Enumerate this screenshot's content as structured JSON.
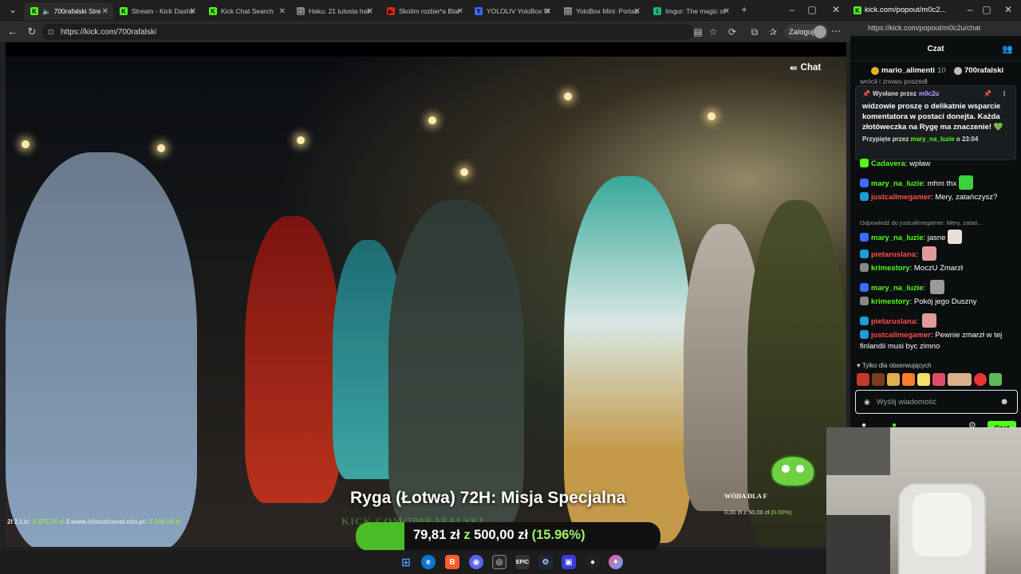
{
  "main_window": {
    "tabs": [
      {
        "label": "700rafalski Stre",
        "favicon": "kick-icon",
        "active": true
      },
      {
        "label": "Stream - Kick Dashb",
        "favicon": "kick-icon",
        "active": false
      },
      {
        "label": "Kick Chat Search",
        "favicon": "chat-search-icon",
        "active": false
      },
      {
        "label": "Haku: 21 tulosta hak",
        "favicon": "page-icon",
        "active": false
      },
      {
        "label": "Skolim rozbie*a Blar",
        "favicon": "youtube-icon",
        "active": false
      },
      {
        "label": "YOLOLIV YoloBox M",
        "favicon": "yololiv-icon",
        "active": false
      },
      {
        "label": "YoloBox Mini: Portab",
        "favicon": "page-icon",
        "active": false
      },
      {
        "label": "Imgur: The magic of",
        "favicon": "imgur-icon",
        "active": false
      }
    ],
    "url": "https://kick.com/700rafalski",
    "login_label": "Zaloguj"
  },
  "video": {
    "chat_toggle_label": "Chat",
    "headline": "Ryga (Łotwa) 72H: Misja Specjalna",
    "donors_text_pre": "2ł   2.Liz: ",
    "donor2_amount": "2 575.76 zł",
    "donors_text_mid": "   3.www.hitoszkomat.cba.pl: ",
    "donor3_amount": "2 106.06 zł",
    "watermark": "KICK.COM/700RAFALSKI",
    "goal": {
      "current": "79,81 zł",
      "connector": "z",
      "target": "500,00 zł",
      "percent_label": "(15.96%)",
      "progress": 0.1596
    },
    "mascot_label": "WÓDA DLA F",
    "mascot_goal_current": "0,00 zł z 50,00 zł",
    "mascot_goal_pct": "(0.00%)"
  },
  "chat_window": {
    "title": "kick.com/popout/m0c2...",
    "url": "https://kick.com/popout/m0c2u/chat",
    "header_title": "Czat",
    "leaderboard": [
      {
        "user": "mario_alimenti",
        "count": "10",
        "medal_color": "#e6b422"
      },
      {
        "user": "700rafalski",
        "count": "",
        "medal_color": "#c0c0c0"
      }
    ],
    "overflow_text": "wrócił i znowu poszedł",
    "pinned": {
      "sent_by_label": "Wysłane przez",
      "sender": "m0c2u",
      "message": "widzowie proszę o delikatnie wsparcie komentatora w postaci donejta. Każda złotóweczka na Rygę ma znaczenie! 💚",
      "pinned_by_label": "Przypięte przez",
      "pinned_by_user": "mary_na_luzie",
      "pinned_time": "o 23:04"
    },
    "messages": [
      {
        "user": "Cadavera",
        "text": "wpław",
        "user_color": "#53fc18"
      },
      {
        "user": "mary_na_luzie",
        "text": "mhm thx",
        "user_color": "#53fc18"
      },
      {
        "user": "justcallmegamer",
        "text": "Mery, zatańczysz?",
        "user_color": "#ff4d4d"
      },
      {
        "user": "mary_na_luzie",
        "text": "jasne",
        "user_color": "#53fc18",
        "reply_to": "Odpowiedź do justcallmegamer: Mery, zatań..."
      },
      {
        "user": "pietaruslana",
        "text": "",
        "user_color": "#ff4d4d"
      },
      {
        "user": "krimestory",
        "text": "MoczU Zmarzł",
        "user_color": "#53fc18"
      },
      {
        "user": "mary_na_luzie",
        "text": "",
        "user_color": "#53fc18"
      },
      {
        "user": "krimestory",
        "text": "Pokój jego Duszny",
        "user_color": "#53fc18"
      },
      {
        "user": "pietaruslana",
        "text": "",
        "user_color": "#ff4d4d"
      },
      {
        "user": "justcallmegamer",
        "text": "Pewnie zmarzł w tej finlandii musi byc zimno",
        "user_color": "#ff4d4d"
      }
    ],
    "followers_only": "Tylko dla obserwujących",
    "input_placeholder": "Wyślij wiadomość",
    "send_label": "Czat"
  }
}
